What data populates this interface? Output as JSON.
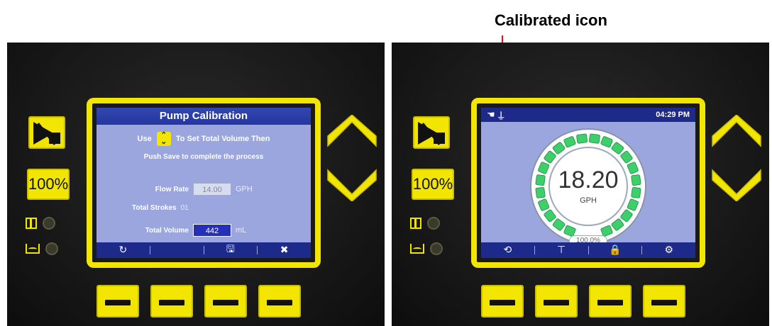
{
  "annotation": {
    "text": "Calibrated icon",
    "arrow_color": "#e01010"
  },
  "device": {
    "accent_color": "#f2e600",
    "speed_button": "100%",
    "icons": [
      "start-stop-icon",
      "stop-indicator-icon",
      "tank-level-icon",
      "chevron-up-icon",
      "chevron-down-icon",
      "soft-key-dash-icon"
    ]
  },
  "calibration_screen": {
    "title": "Pump Calibration",
    "instruction_pre": "Use",
    "instruction_post": "To Set Total Volume Then",
    "instruction2": "Push Save to complete the process",
    "flow_rate": {
      "label": "Flow Rate",
      "value": "14.00",
      "unit": "GPH"
    },
    "total_strokes": {
      "label": "Total Strokes",
      "value": "01"
    },
    "total_volume": {
      "label": "Total Volume",
      "value": "442",
      "unit": "mL"
    },
    "softkeys": [
      "refresh-icon",
      "save-icon",
      "close-icon"
    ]
  },
  "run_screen": {
    "time": "04:29 PM",
    "status_icons": [
      "hand-manual-icon",
      "calibrated-icon"
    ],
    "flow_value": "18.20",
    "flow_unit": "GPH",
    "speed_percent": "100.0%",
    "gauge_fill_fraction": 1.0,
    "gauge_color": "#3ccf6a",
    "softkeys": [
      "cycle-icon",
      "prime-icon",
      "lock-icon",
      "settings-icon"
    ]
  }
}
